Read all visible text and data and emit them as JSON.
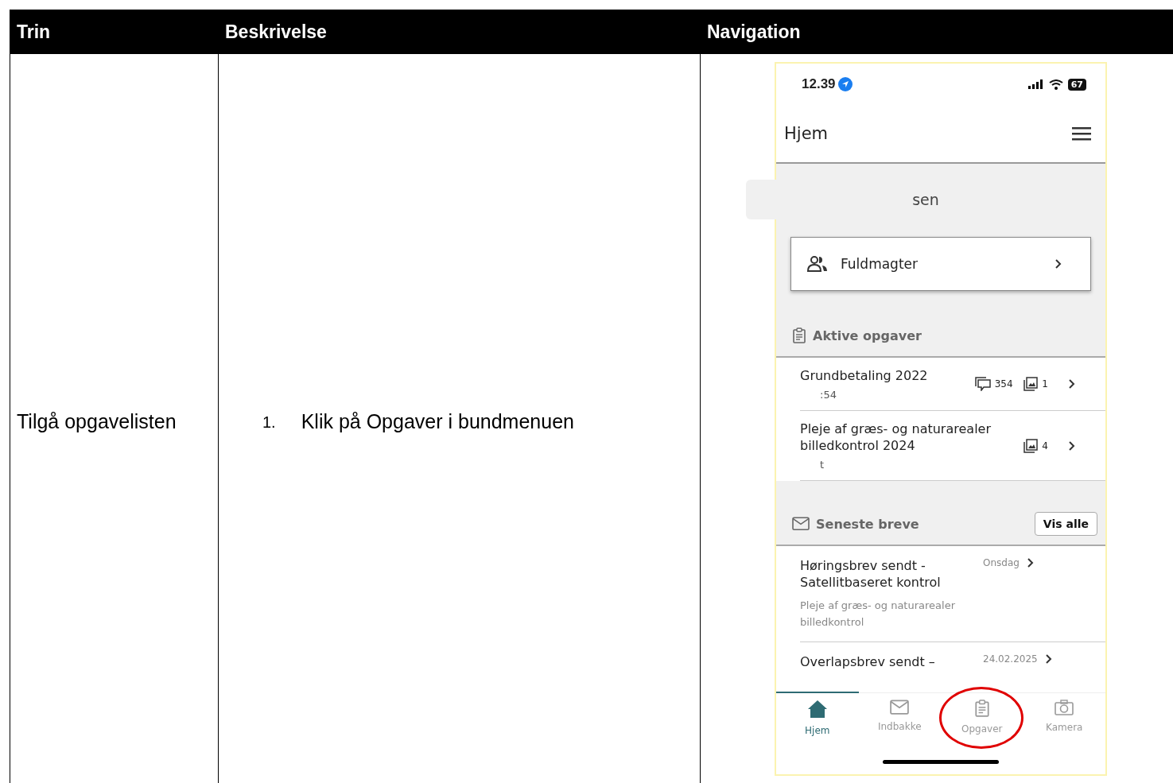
{
  "table": {
    "columns": [
      "Trin",
      "Beskrivelse",
      "Navigation"
    ],
    "rows": [
      {
        "step": "Tilgå opgavelisten",
        "instructions": [
          {
            "number": "1.",
            "text": "Klik på Opgaver i bundmenuen"
          }
        ],
        "screenshot": {
          "status_bar": {
            "time": "12.39",
            "battery": "67"
          },
          "header": {
            "title": "Hjem"
          },
          "banner": {
            "text": "sen"
          },
          "delegations": {
            "label": "Fuldmagter"
          },
          "active_tasks": {
            "title": "Aktive opgaver",
            "items": [
              {
                "title": "Grundbetaling 2022",
                "subtitle": ":54",
                "comments": "354",
                "images": "1"
              },
              {
                "title": "Pleje af græs- og naturarealer billedkontrol 2024",
                "subtitle": "t",
                "images": "4"
              }
            ]
          },
          "letters": {
            "title": "Seneste breve",
            "button": "Vis alle",
            "items": [
              {
                "title": "Høringsbrev sendt - Satellitbaseret kontrol",
                "subtitle": "Pleje af græs- og naturarealer billedkontrol",
                "date": "Onsdag"
              },
              {
                "title": "Overlapsbrev sendt –",
                "date": "24.02.2025"
              }
            ]
          },
          "bottom_nav": [
            {
              "kind": "home",
              "label": "Hjem",
              "selected": true,
              "circled": false
            },
            {
              "kind": "inbox",
              "label": "Indbakke",
              "selected": false,
              "circled": false
            },
            {
              "kind": "tasks",
              "label": "Opgaver",
              "selected": false,
              "circled": true
            },
            {
              "kind": "camera",
              "label": "Kamera",
              "selected": false,
              "circled": false
            }
          ]
        }
      }
    ]
  }
}
